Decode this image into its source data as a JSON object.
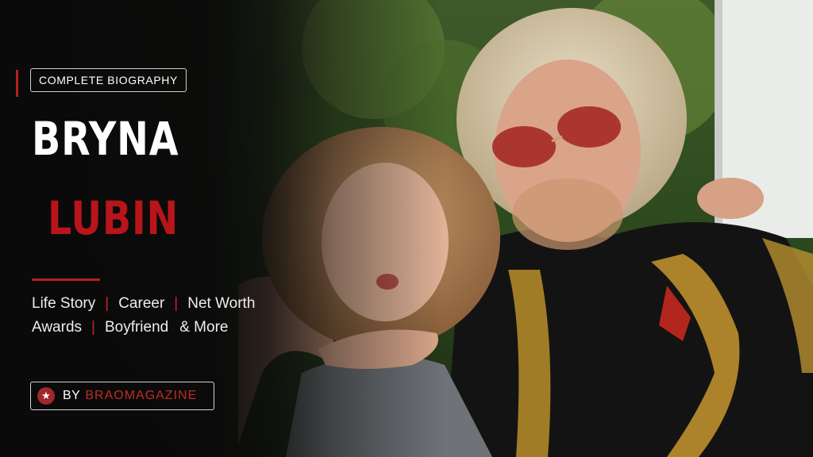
{
  "tag_label": "COMPLETE BIOGRAPHY",
  "name": {
    "first": "BRYNA",
    "last": "LUBIN"
  },
  "topics": {
    "row1": [
      "Life Story",
      "Career",
      "Net Worth"
    ],
    "row2": [
      "Awards",
      "Boyfriend",
      "& More"
    ],
    "separator": "|"
  },
  "byline": {
    "icon": "star-icon",
    "by": "BY",
    "brand": "BRAOMAGAZINE"
  },
  "colors": {
    "accent": "#b8151a",
    "background": "#0b0b0b",
    "text": "#ffffff"
  }
}
